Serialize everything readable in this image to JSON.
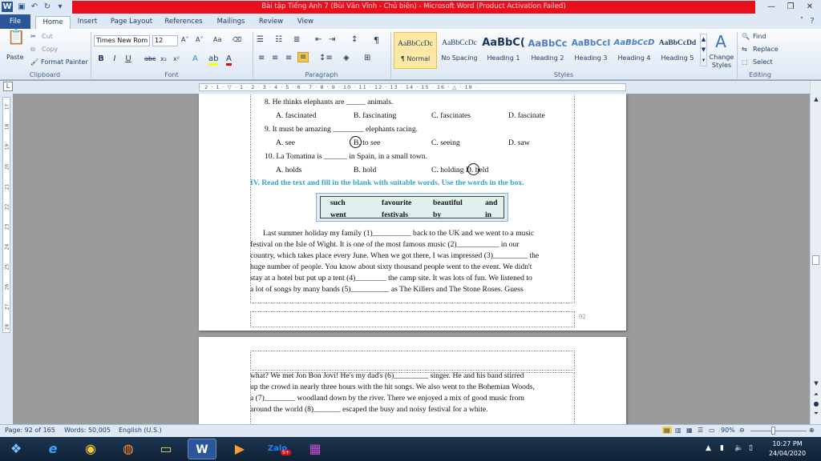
{
  "window": {
    "title": "Bài tập Tiếng Anh 7 (Bùi Văn Vĩnh - Chủ biên)  -  Microsoft Word (Product Activation Failed)",
    "app_icon": "W"
  },
  "quick_access": [
    "save-icon",
    "undo-icon",
    "redo-icon",
    "customize-icon"
  ],
  "tabs": [
    "File",
    "Home",
    "Insert",
    "Page Layout",
    "References",
    "Mailings",
    "Review",
    "View"
  ],
  "active_tab": "Home",
  "ribbon": {
    "clipboard": {
      "paste": "Paste",
      "cut": "Cut",
      "copy": "Copy",
      "format_painter": "Format Painter",
      "label": "Clipboard"
    },
    "font": {
      "name": "Times New Rom",
      "size": "12",
      "label": "Font",
      "bold": "B",
      "italic": "I",
      "underline": "U",
      "strike": "abc",
      "sub": "x₂",
      "sup": "x²",
      "grow": "A˄",
      "shrink": "A˅",
      "case": "Aa",
      "highlight_color": "#ffff00",
      "font_color": "#ff0000"
    },
    "paragraph": {
      "label": "Paragraph",
      "pilcrow": "¶"
    },
    "styles": {
      "label": "Styles",
      "items": [
        {
          "preview": "AaBbCcDc",
          "name": "¶ Normal"
        },
        {
          "preview": "AaBbCcDc",
          "name": "No Spacing"
        },
        {
          "preview": "AaBbC(",
          "name": "Heading 1"
        },
        {
          "preview": "AaBbCc",
          "name": "Heading 2"
        },
        {
          "preview": "AaBbCcI",
          "name": "Heading 3"
        },
        {
          "preview": "AaBbCcD",
          "name": "Heading 4"
        },
        {
          "preview": "AaBbCcDd",
          "name": "Heading 5"
        }
      ],
      "change_styles": "Change Styles"
    },
    "editing": {
      "label": "Editing",
      "find": "Find",
      "replace": "Replace",
      "select": "Select"
    }
  },
  "ruler": {
    "marks": "· 2 · 1 · ▽ · 1 · 2 · 3 · 4 · 5 · 6 · 7 · 8 · 9 · 10 · 11 · 12 · 13 · 14 · 15 · 16 · △ · 18 ·",
    "v_marks": [
      "17",
      "18",
      "19",
      "20",
      "21",
      "22",
      "23",
      "24",
      "25",
      "26",
      "27",
      "28"
    ]
  },
  "document": {
    "q8": {
      "text": "8.   He thinks elephants are _____ animals.",
      "a": "A.  fascinated",
      "b": "B.  fascinating",
      "c": "C.  fascinates",
      "d": "D.  fascinate"
    },
    "q9": {
      "text": "9.   It must be amazing ________ elephants racing.",
      "a": "A.  see",
      "b": "B.  to see",
      "c": "C.  seeing",
      "d": "D.  saw"
    },
    "q10": {
      "text": "10. La Tomatina is ______ in Spain, in a small town.",
      "a": "A.  holds",
      "b": "B.  hold",
      "c": "C.  holding",
      "d": "D.  held"
    },
    "section_iv": "IV. Read the text and fill in the blank with suitable words. Use the words in the box.",
    "word_box": [
      [
        "such",
        "favourite",
        "beautiful",
        "and"
      ],
      [
        "went",
        "festivals",
        "by",
        "in"
      ]
    ],
    "passage_p1": [
      "Last summer holiday my family (1)__________ back to the UK and we went to a music",
      "festival on the Isle of Wight. It is one of the most famous music (2)___________ in        our",
      "country, which takes place every June. When we got there, I was impressed (3)_________ the",
      "huge number of people. You know about sixty thousand people went to the event. We didn't",
      "stay at a hotel but put up a tent (4)________ the camp site. It was lots of fun. We listened to",
      "a lot of songs by many bands (5)__________ as  The  Killers  and  The  Stone  Roses.  Guess"
    ],
    "page_number": "92",
    "passage_p2": [
      "what? We met Jon Bon Jovi! He's my dad's (6)_________ singer.  He  and  his band  stirred",
      "up the crowd in nearly three hours with the hit songs. We also went to the Bohemian Woods,",
      "a (7)________  woodland down by the river. There we enjoyed a mix of good music from",
      "around the world (8)_______ escaped the busy and noisy festival for a white."
    ]
  },
  "status": {
    "page": "Page: 92 of 165",
    "words": "Words: 50,005",
    "language": "English (U.S.)",
    "zoom": "90%"
  },
  "taskbar": {
    "apps": [
      "start-icon",
      "ie-icon",
      "chrome-icon",
      "firefox-icon",
      "explorer-icon",
      "word-icon",
      "media-icon",
      "zalo-icon",
      "winrar-icon"
    ],
    "zalo_badge": "5+",
    "time": "10:27 PM",
    "date": "24/04/2020"
  }
}
